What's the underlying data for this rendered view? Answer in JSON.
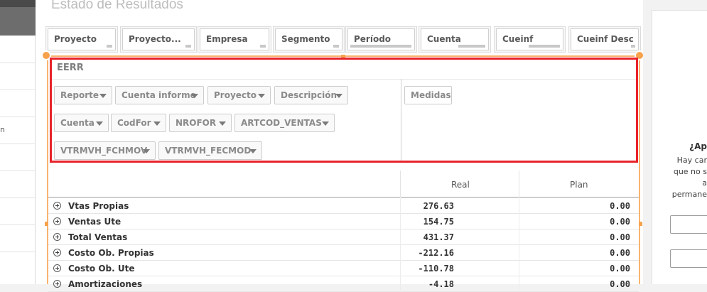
{
  "sheet": {
    "title": "Estado de Resultados"
  },
  "sidebar": {
    "fragment": "n"
  },
  "filters": [
    {
      "label": "Proyecto"
    },
    {
      "label": "Proyecto..."
    },
    {
      "label": "Empresa"
    },
    {
      "label": "Segmento"
    },
    {
      "label": "Período"
    },
    {
      "label": "Cuenta"
    },
    {
      "label": "Cueinf"
    },
    {
      "label": "Cueinf Desc"
    }
  ],
  "pivot": {
    "title": "EERR",
    "row_dimensions": [
      "Reporte",
      "Cuenta informe",
      "Proyecto",
      "Descripción",
      "Cuenta",
      "CodFor",
      "NROFOR",
      "ARTCOD_VENTAS",
      "VTRMVH_FCHMOV",
      "VTRMVH_FECMOD"
    ],
    "column_dimension": "Medidas"
  },
  "table": {
    "columns": [
      "Real",
      "Plan"
    ],
    "rows": [
      {
        "label": "Vtas Propias",
        "real": "276.63",
        "plan": "0.00"
      },
      {
        "label": "Ventas Ute",
        "real": "154.75",
        "plan": "0.00"
      },
      {
        "label": "Total Ventas",
        "real": "431.37",
        "plan": "0.00"
      },
      {
        "label": "Costo Ob. Propias",
        "real": "-212.16",
        "plan": "0.00"
      },
      {
        "label": "Costo Ob. Ute",
        "real": "-110.78",
        "plan": "0.00"
      },
      {
        "label": "Amortizaciones",
        "real": "-4.18",
        "plan": "0.00"
      }
    ]
  },
  "right_panel": {
    "heading": "¿Ap",
    "lines": [
      "Hay car",
      "que no s",
      "a",
      "permane"
    ]
  }
}
